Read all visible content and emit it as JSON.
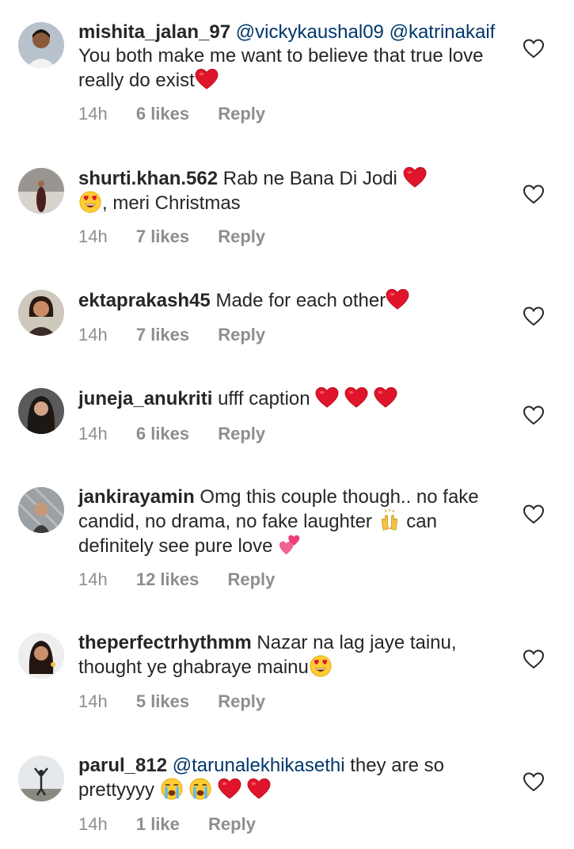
{
  "comments": [
    {
      "username": "mishita_jalan_97",
      "mention1": "@vickykaushal09",
      "mention2": "@katrinakaif",
      "text": "You both make me want to believe that true love really do exist",
      "time": "14h",
      "likes": "6 likes",
      "reply": "Reply"
    },
    {
      "username": "shurti.khan.562",
      "text1": "Rab ne Bana Di Jodi",
      "text2": ", meri Christmas",
      "time": "14h",
      "likes": "7 likes",
      "reply": "Reply"
    },
    {
      "username": "ektaprakash45",
      "text": "Made for each other",
      "time": "14h",
      "likes": "7 likes",
      "reply": "Reply"
    },
    {
      "username": "juneja_anukriti",
      "text": "ufff caption",
      "time": "14h",
      "likes": "6 likes",
      "reply": "Reply"
    },
    {
      "username": "jankirayamin",
      "text1": "Omg this couple though.. no fake candid, no drama, no fake laughter",
      "text2": "can definitely see pure love",
      "time": "14h",
      "likes": "12 likes",
      "reply": "Reply"
    },
    {
      "username": "theperfectrhythmm",
      "text": "Nazar na lag jaye tainu, thought ye ghabraye mainu",
      "time": "14h",
      "likes": "5 likes",
      "reply": "Reply"
    },
    {
      "username": "parul_812",
      "mention1": "@tarunalekhikasethi",
      "text": "they are so prettyyyy",
      "time": "14h",
      "likes": "1 like",
      "reply": "Reply"
    }
  ],
  "icons": {
    "like": "heart-outline-icon",
    "red_heart": "red-heart-emoji",
    "heart_eyes": "heart-eyes-emoji",
    "raised_hands": "raised-hands-emoji",
    "two_hearts": "two-hearts-emoji",
    "crying": "loudly-crying-emoji"
  },
  "colors": {
    "text": "#262626",
    "meta": "#8e8e8e",
    "mention": "#00376b",
    "heart": "#e0152b"
  }
}
